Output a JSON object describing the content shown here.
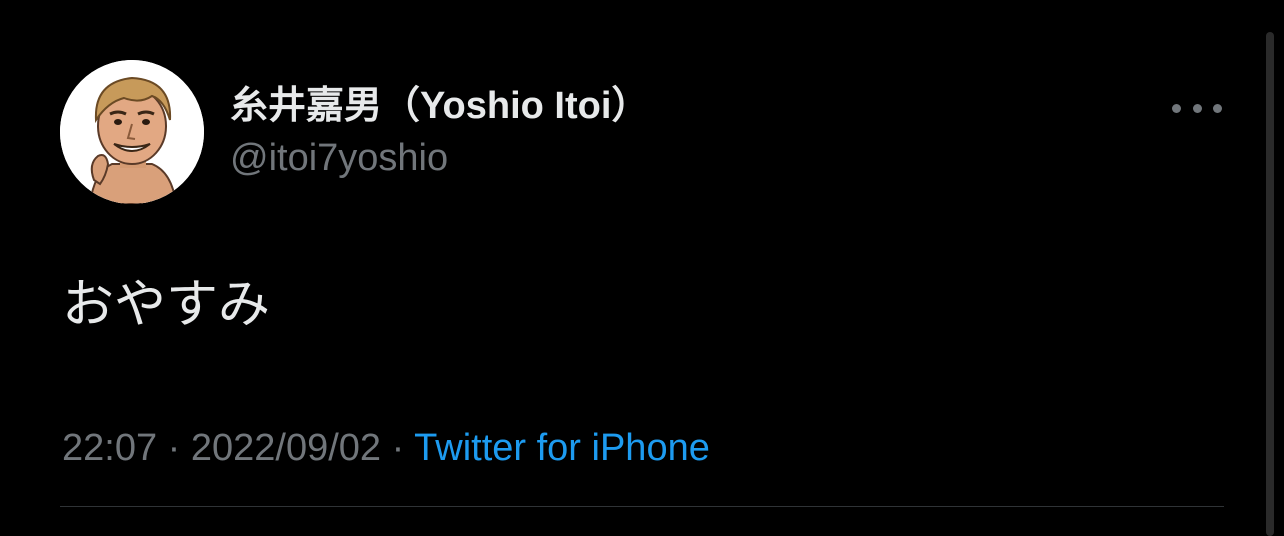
{
  "tweet": {
    "author": {
      "display_name": "糸井嘉男（Yoshio Itoi）",
      "handle": "@itoi7yoshio",
      "avatar_icon": "avatar-illustration-icon"
    },
    "more_icon": "more-horizontal-icon",
    "text": "おやすみ",
    "time": "22:07",
    "separator": " · ",
    "date": "2022/09/02",
    "source": "Twitter for iPhone"
  },
  "colors": {
    "background": "#000000",
    "primary_text": "#e7e9ea",
    "secondary_text": "#71767b",
    "link": "#1d9bf0",
    "divider": "#2f3336"
  }
}
